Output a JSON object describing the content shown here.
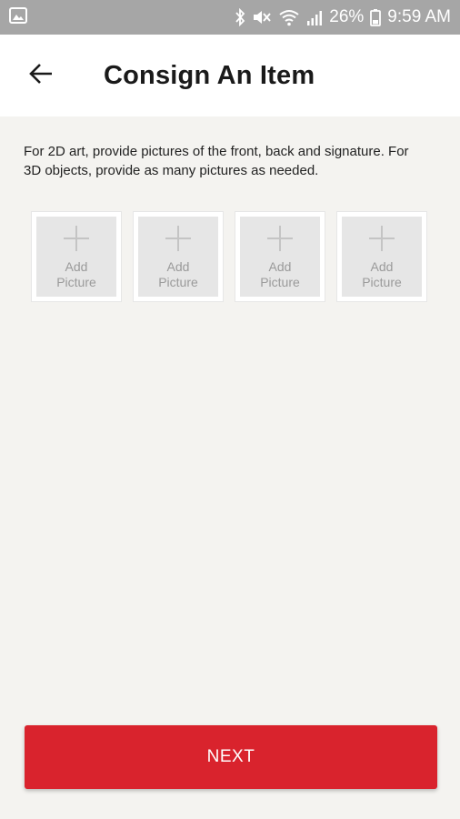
{
  "status_bar": {
    "battery": "26%",
    "time": "9:59 AM",
    "icons": [
      "image-icon",
      "bluetooth-icon",
      "mute-icon",
      "wifi-icon",
      "signal-icon",
      "battery-icon"
    ]
  },
  "header": {
    "title": "Consign An Item",
    "back_icon": "arrow-left-icon"
  },
  "instructions": "For 2D art, provide pictures of the front, back and signature. For 3D objects, provide as many pictures as needed.",
  "pictures": [
    {
      "label": "Add\nPicture"
    },
    {
      "label": "Add\nPicture"
    },
    {
      "label": "Add\nPicture"
    },
    {
      "label": "Add\nPicture"
    }
  ],
  "next_button": {
    "label": "NEXT"
  },
  "colors": {
    "status_bar": "#a6a6a6",
    "background": "#f4f3f0",
    "accent": "#d9232d"
  }
}
